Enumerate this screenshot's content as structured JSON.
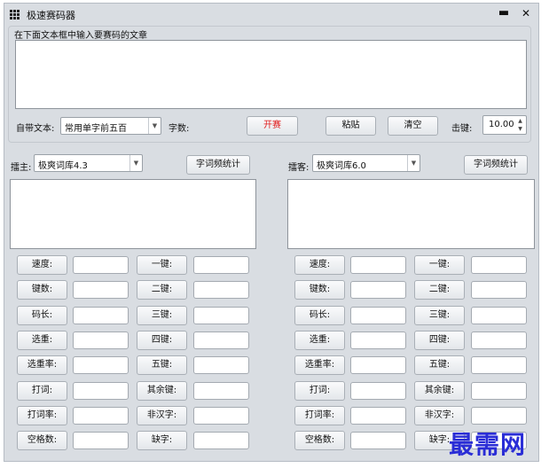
{
  "window": {
    "title": "极速赛码器",
    "min_glyph": "▬",
    "close_glyph": "✕"
  },
  "top": {
    "prompt": "在下面文本框中输入要赛码的文章",
    "article_text": "",
    "builtin_label": "自带文本:",
    "builtin_value": "常用单字前五百",
    "wordcount_label": "字数:",
    "start_label": "开赛",
    "paste_label": "粘贴",
    "clear_label": "清空",
    "keystroke_label": "击键:",
    "keystroke_value": "10.00"
  },
  "left": {
    "player_label": "擂主:",
    "dict_value": "极爽词库4.3",
    "stats_button": "字词频统计",
    "output_text": ""
  },
  "right": {
    "player_label": "擂客:",
    "dict_value": "极爽词库6.0",
    "stats_button": "字词频统计",
    "output_text": ""
  },
  "stats": {
    "col1": [
      "速度:",
      "键数:",
      "码长:",
      "选重:",
      "选重率:",
      "打词:",
      "打词率:",
      "空格数:"
    ],
    "col2": [
      "一键:",
      "二键:",
      "三键:",
      "四键:",
      "五键:",
      "其余键:",
      "非汉字:",
      "缺字:"
    ]
  },
  "watermark": "最需网",
  "colors": {
    "accent_red": "#e02020",
    "window_bg": "#d9dde2",
    "watermark": "#2a2dd6"
  },
  "icons": {
    "app": "grid-icon",
    "dropdown": "chevron-down-icon",
    "spin": "spin-arrows-icon"
  }
}
